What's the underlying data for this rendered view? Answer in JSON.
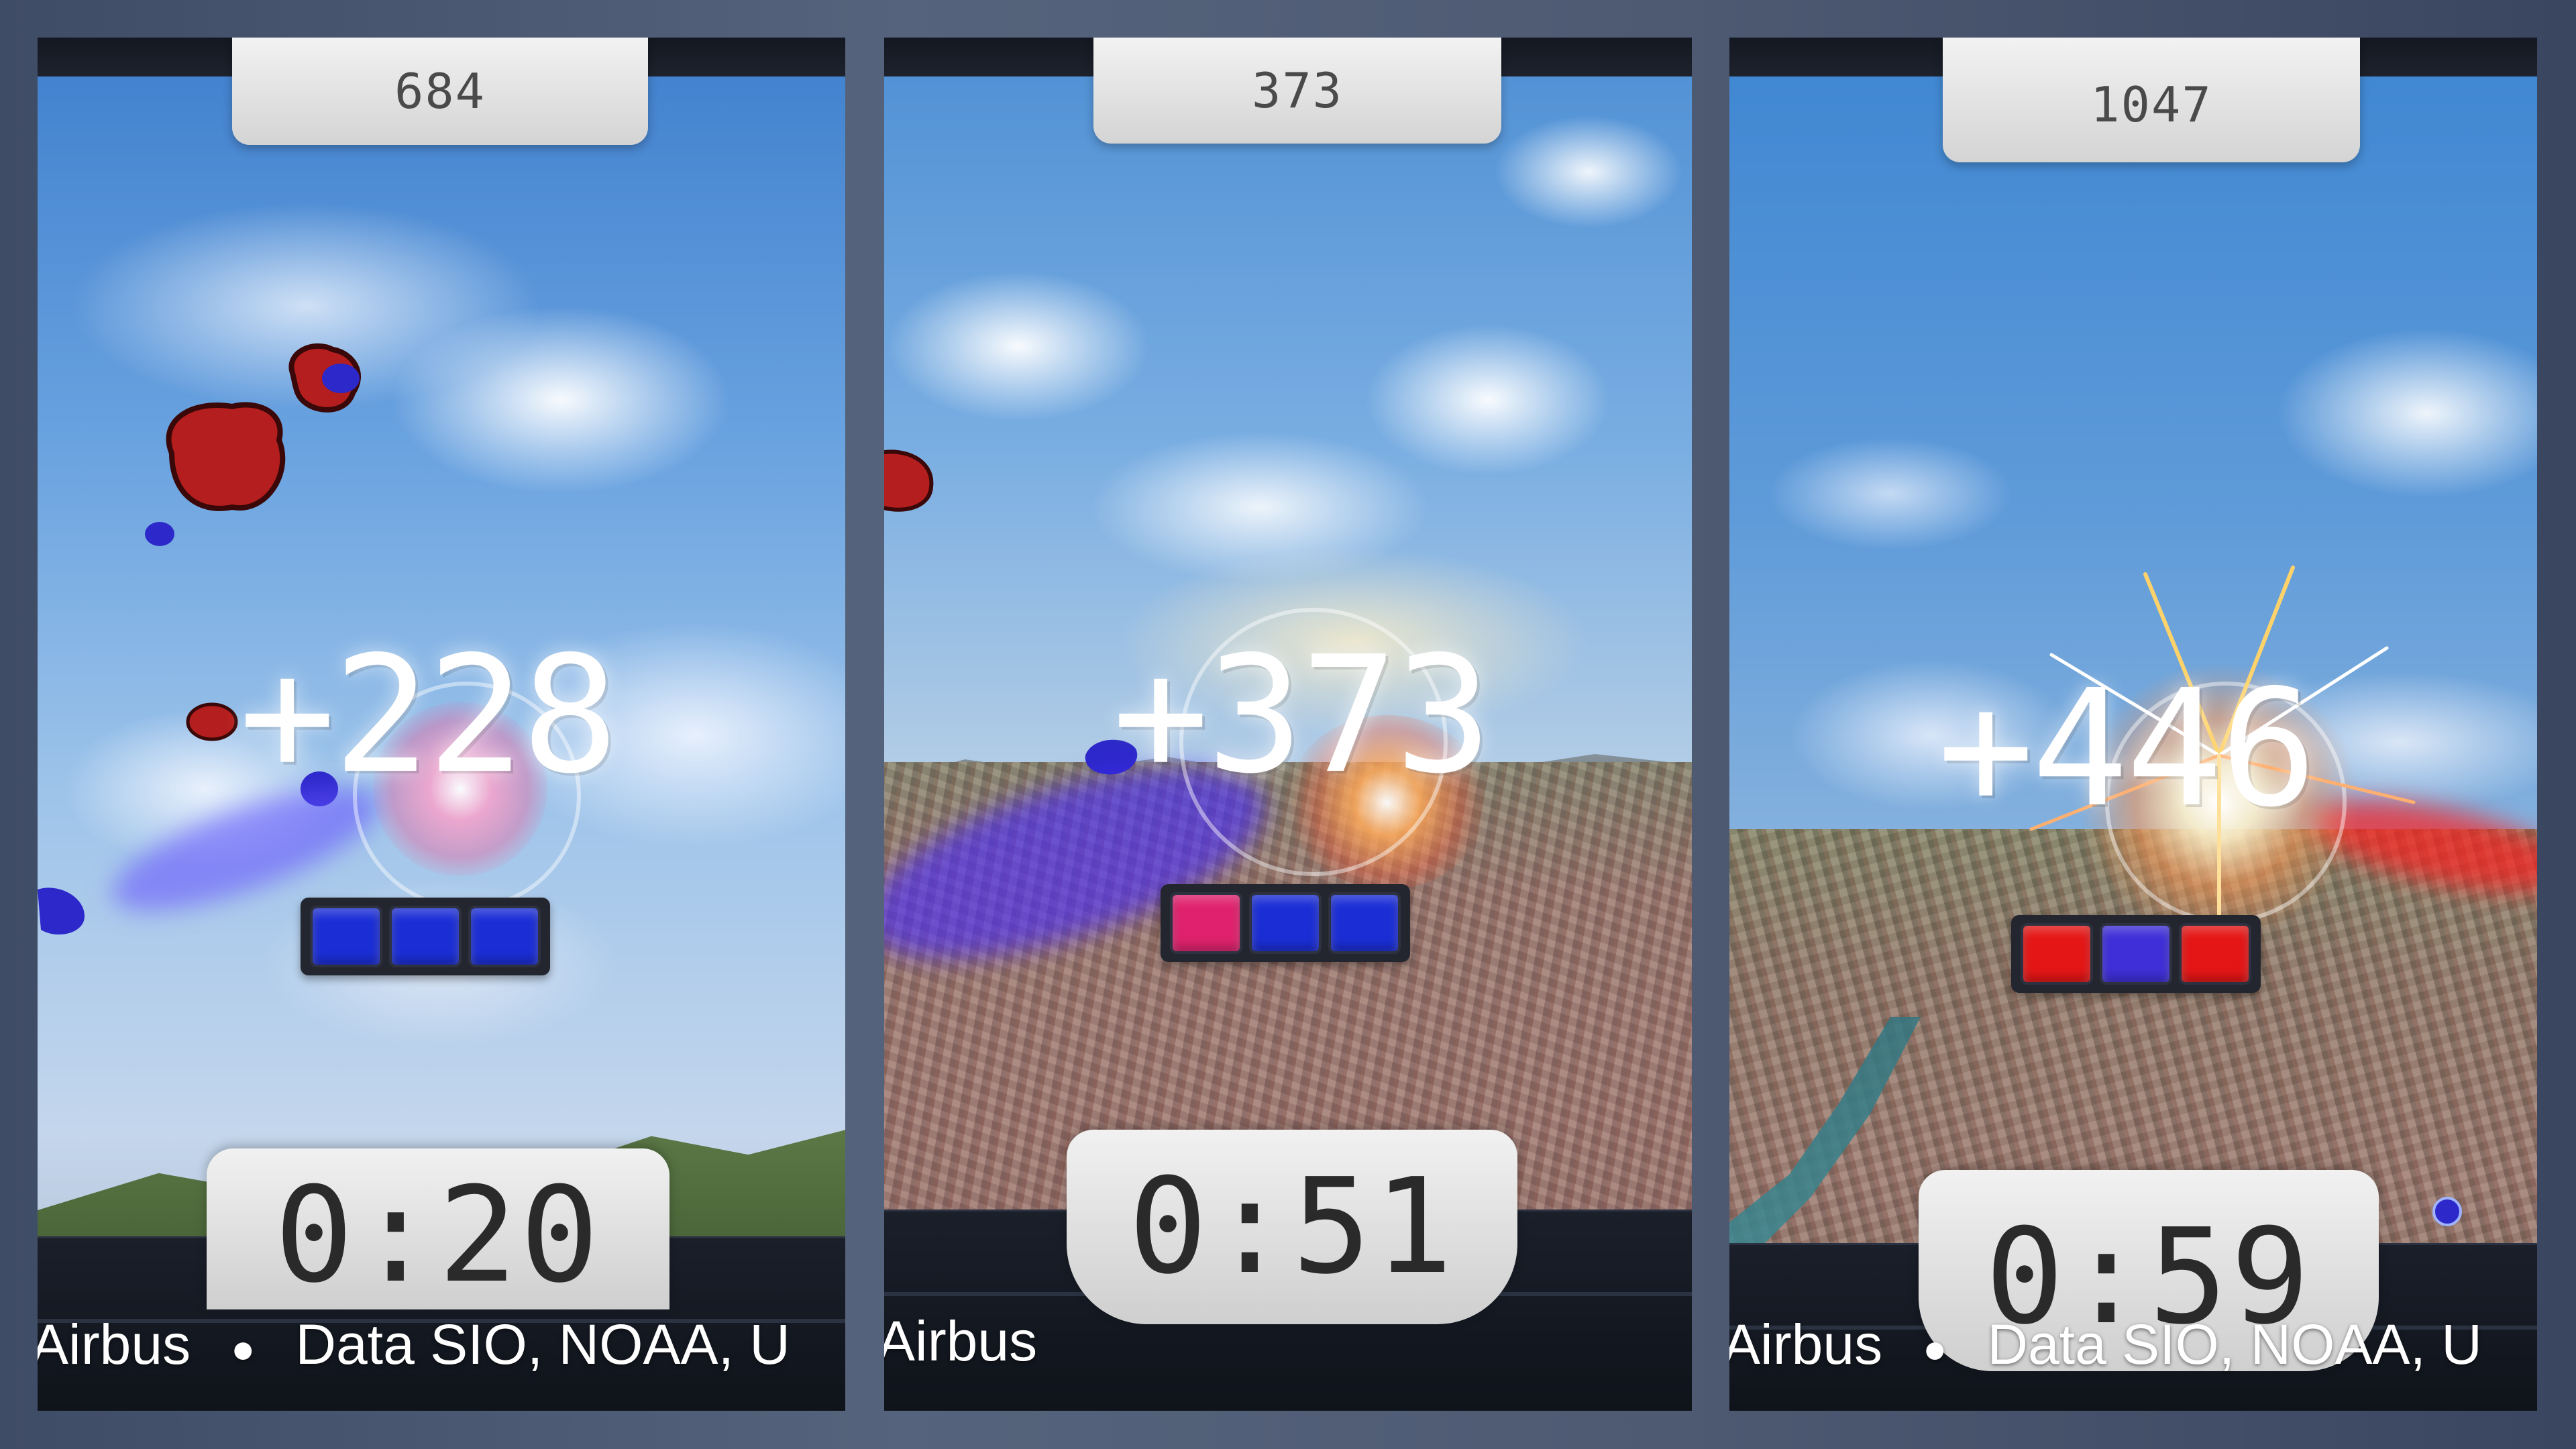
{
  "panels": [
    {
      "score": "684",
      "points": "+228",
      "timer": "0:20",
      "combo": [
        "#1b2ed6",
        "#1b2ed6",
        "#1b2ed6"
      ],
      "attribution": {
        "left": "Airbus",
        "right": "Data SIO, NOAA, U"
      }
    },
    {
      "score": "373",
      "points": "+373",
      "timer": "0:51",
      "combo": [
        "#e0226e",
        "#1b2ed6",
        "#1b2ed6"
      ],
      "attribution": {
        "left": "Airbus",
        "right": ""
      }
    },
    {
      "score": "1047",
      "points": "+446",
      "timer": "0:59",
      "combo": [
        "#e51616",
        "#3e2fd8",
        "#e51616"
      ],
      "attribution": {
        "left": "Airbus",
        "right": "Data SIO, NOAA, U"
      }
    }
  ],
  "colors": {
    "red_blob": "#b51e1e",
    "blue_blob": "#2c28c9",
    "tab_bg": "#e2e2e2",
    "bezel": "#1a1f2a"
  },
  "icons": {
    "separator": "bullet-dot-icon"
  }
}
